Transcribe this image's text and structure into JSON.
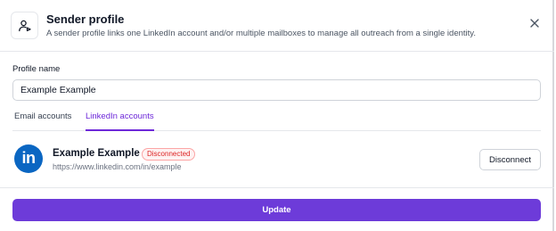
{
  "dialog": {
    "title": "Sender profile",
    "description": "A sender profile links one LinkedIn account and/or multiple mailboxes to manage all outreach from a single identity.",
    "header_icon": "user-send-icon",
    "close_icon": "close-icon"
  },
  "form": {
    "profile_name_label": "Profile name",
    "profile_name_value": "Example Example"
  },
  "tabs": [
    {
      "label": "Email accounts",
      "active": false
    },
    {
      "label": "LinkedIn accounts",
      "active": true
    }
  ],
  "linkedin_account": {
    "logo_text": "in",
    "name": "Example Example",
    "status": "Disconnected",
    "url": "https://www.linkedin.com/in/example",
    "disconnect_label": "Disconnect"
  },
  "footer": {
    "update_label": "Update"
  },
  "colors": {
    "accent": "#6d3bd9",
    "linkedin": "#0a66c2",
    "status_error": "#dc2626"
  }
}
